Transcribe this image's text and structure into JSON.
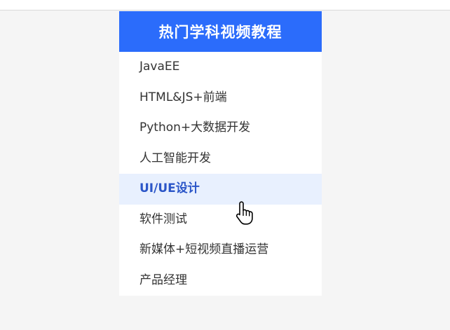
{
  "menu": {
    "title": "热门学科视频教程",
    "accent_color": "#2b6cfb",
    "items": [
      {
        "label": "JavaEE"
      },
      {
        "label": "HTML&JS+前端"
      },
      {
        "label": "Python+大数据开发"
      },
      {
        "label": "人工智能开发"
      },
      {
        "label": "UI/UE设计",
        "active": true
      },
      {
        "label": "软件测试"
      },
      {
        "label": "新媒体+短视频直播运营"
      },
      {
        "label": "产品经理"
      }
    ]
  },
  "cursor": {
    "icon": "hand-pointer-icon"
  }
}
